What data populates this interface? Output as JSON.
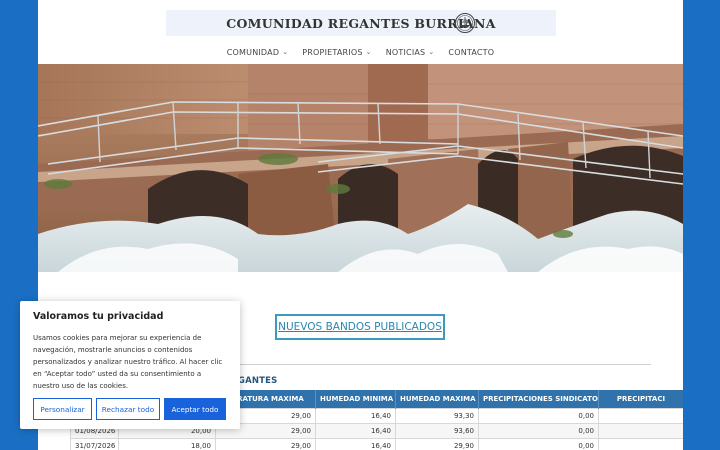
{
  "site": {
    "title": "COMUNIDAD REGANTES BURRIANA"
  },
  "icons": {
    "logo": "ship-emblem-icon",
    "chevron": "chevron-down-icon"
  },
  "nav": {
    "items": [
      {
        "label": "COMUNIDAD",
        "has_dropdown": true
      },
      {
        "label": "PROPIETARIOS",
        "has_dropdown": true
      },
      {
        "label": "NOTICIAS",
        "has_dropdown": true
      },
      {
        "label": "CONTACTO",
        "has_dropdown": false
      }
    ],
    "chevron": "⌄"
  },
  "main": {
    "bandos_button": "NUEVOS BANDOS PUBLICADOS",
    "table_title": "ZADAS POR LA COMUNIDAD DE REGANTES"
  },
  "table": {
    "headers": [
      "",
      "",
      "PERATURA MAXIMA",
      "HUMEDAD MINIMA",
      "HUMEDAD MAXIMA",
      "PRECIPITACIONES SINDICATO",
      "PRECIPITACI"
    ],
    "rows": [
      [
        "",
        "",
        "29,00",
        "16,40",
        "93,30",
        "0,00",
        ""
      ],
      [
        "01/08/2026",
        "20,00",
        "29,00",
        "16,40",
        "93,60",
        "0,00",
        ""
      ],
      [
        "31/07/2026",
        "18,00",
        "29,00",
        "16,40",
        "29,90",
        "0,00",
        ""
      ]
    ]
  },
  "cookie": {
    "title": "Valoramos tu privacidad",
    "text": "Usamos cookies para mejorar su experiencia de navegación, mostrarle anuncios o contenidos personalizados y analizar nuestro tráfico. Al hacer clic en “Aceptar todo” usted da su consentimiento a nuestro uso de las cookies.",
    "customize": "Personalizar",
    "reject": "Rechazar todo",
    "accept": "Aceptar todo"
  },
  "colors": {
    "brand_blue": "#1a6fc4",
    "table_header": "#2f72ac",
    "accent_link": "#2a86b0",
    "cookie_button": "#1863dc"
  }
}
